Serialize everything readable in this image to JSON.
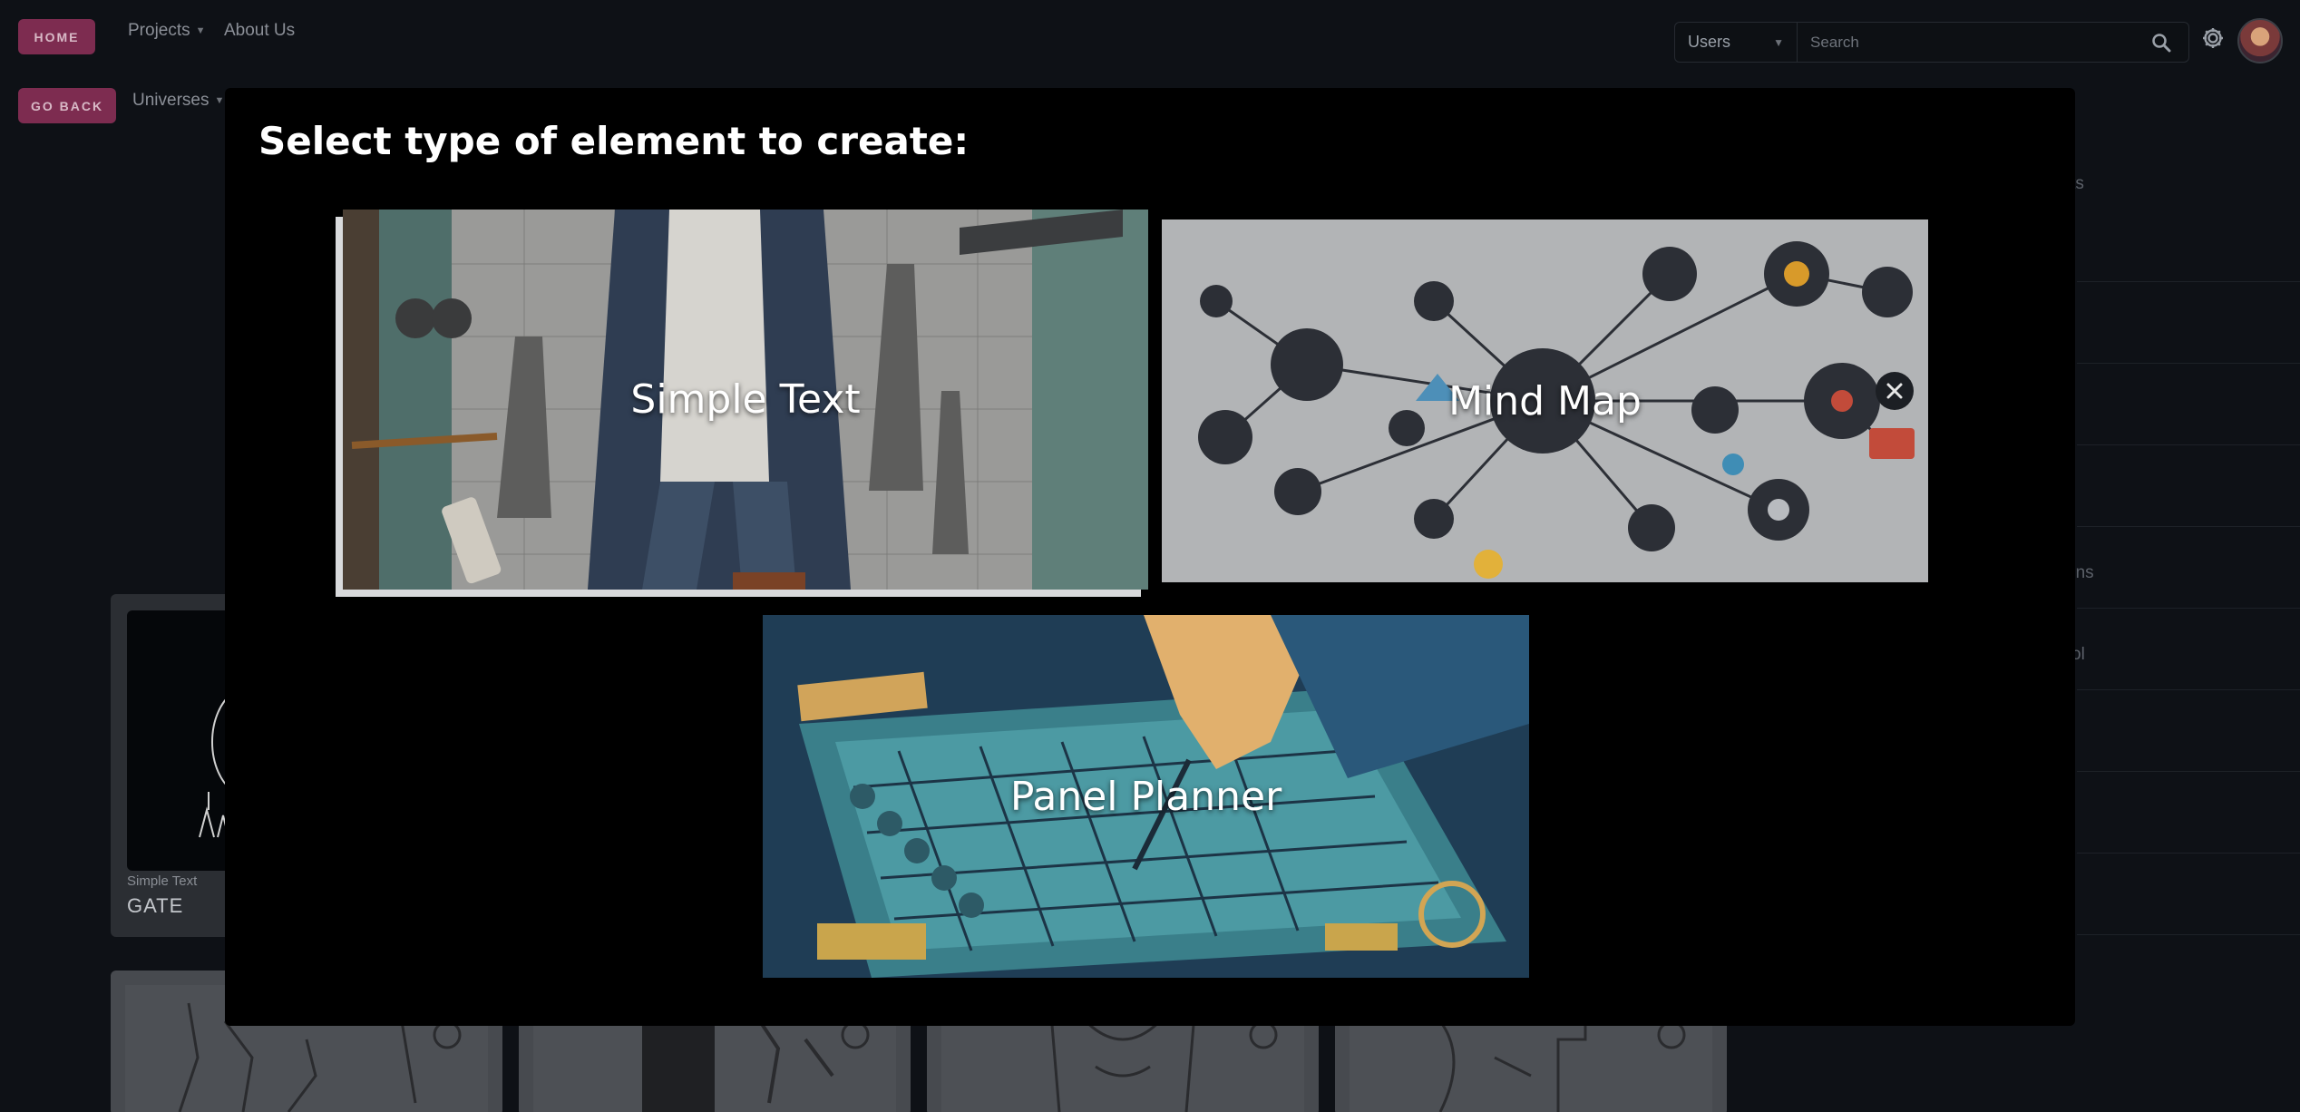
{
  "nav": {
    "home_label": "HOME",
    "projects_label": "Projects",
    "about_label": "About Us",
    "go_back_label": "GO BACK",
    "universes_label": "Universes"
  },
  "search": {
    "scope_value": "Users",
    "placeholder": "Search"
  },
  "background": {
    "right_text_1": "ents",
    "right_text_2": "ons",
    "right_text_3": "ol",
    "card_type": "Simple Text",
    "card_title": "GATE"
  },
  "modal": {
    "title": "Select type of element to create:",
    "options": [
      {
        "label": "Simple Text"
      },
      {
        "label": "Mind Map"
      },
      {
        "label": "Panel Planner"
      }
    ]
  }
}
